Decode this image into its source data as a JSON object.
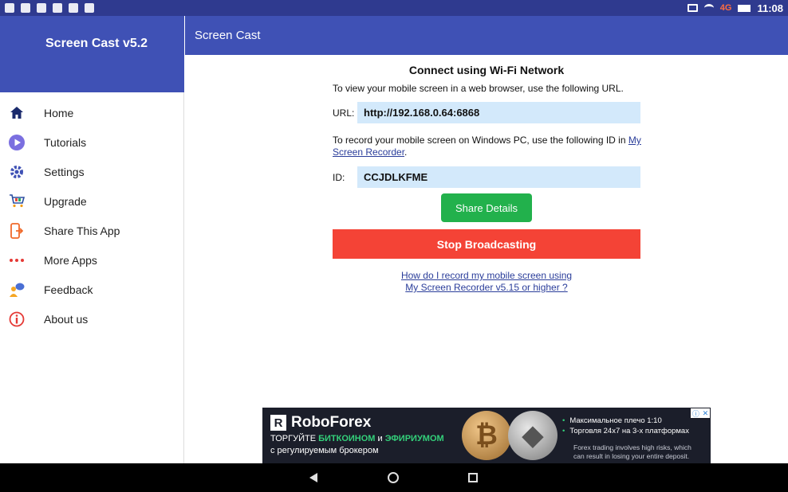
{
  "status_bar": {
    "time": "11:08",
    "network": "4G",
    "icons": [
      "image-icon",
      "youtube-icon",
      "shield-icon",
      "lock-icon",
      "check-icon",
      "telegram-icon",
      "cast-icon",
      "wifi-icon",
      "signal-icon",
      "battery-icon"
    ]
  },
  "drawer": {
    "title": "Screen Cast v5.2",
    "items": [
      {
        "label": "Home",
        "icon": "home-icon"
      },
      {
        "label": "Tutorials",
        "icon": "play-icon"
      },
      {
        "label": "Settings",
        "icon": "gear-icon"
      },
      {
        "label": "Upgrade",
        "icon": "cart-icon"
      },
      {
        "label": "Share This App",
        "icon": "share-icon"
      },
      {
        "label": "More Apps",
        "icon": "dots-icon"
      },
      {
        "label": "Feedback",
        "icon": "feedback-icon"
      },
      {
        "label": "About us",
        "icon": "info-icon"
      }
    ]
  },
  "appbar": {
    "title": "Screen Cast"
  },
  "content": {
    "heading": "Connect using Wi-Fi Network",
    "view_text": "To view your mobile screen in a web browser, use the following URL.",
    "url_label": "URL:",
    "url_value": "http://192.168.0.64:6868",
    "record_text_1": "To record your mobile screen on Windows PC, use the following ID in ",
    "record_link_1": "My",
    "record_link_2": "Screen Recorder",
    "record_text_2": ".",
    "id_label": "ID:",
    "id_value": "CCJDLKFME",
    "share_button": "Share Details",
    "stop_button": "Stop Broadcasting",
    "help_link_1": "How do I record my mobile screen using",
    "help_link_2": "My Screen Recorder v5.15 or higher ?"
  },
  "ad": {
    "brand": "RoboForex",
    "line1_a": "ТОРГУЙТЕ ",
    "line1_b": "БИТКОИНОМ",
    "line1_c": " и ",
    "line1_d": "ЭФИРИУМОМ",
    "line2": "с регулируемым брокером",
    "bullet1": "Максимальное плечо 1:10",
    "bullet2": "Торговля 24x7 на 3-х платформах",
    "disclaimer_1": "Forex trading involves high risks, which",
    "disclaimer_2": "can result in losing your entire deposit."
  },
  "colors": {
    "primary": "#3f51b5",
    "status_bar": "#2f3a8f",
    "share_green": "#22b14c",
    "stop_red": "#f44336",
    "field_bg": "#d3e9fb"
  }
}
